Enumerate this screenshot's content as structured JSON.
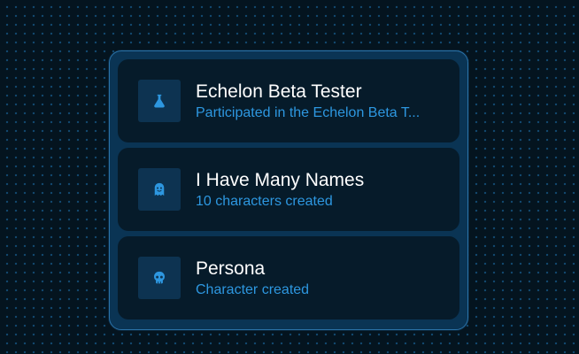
{
  "achievements": [
    {
      "icon": "flask-icon",
      "title": "Echelon Beta Tester",
      "description": "Participated in the Echelon Beta T..."
    },
    {
      "icon": "ghost-icon",
      "title": "I Have Many Names",
      "description": "10 characters created"
    },
    {
      "icon": "skull-icon",
      "title": "Persona",
      "description": "Character created"
    }
  ],
  "colors": {
    "background": "#04141f",
    "panel": "#0a3454",
    "panel_border": "#2a72a8",
    "card": "#061b2a",
    "icon_box": "#0d3351",
    "accent": "#2d97e0",
    "title": "#ffffff"
  }
}
